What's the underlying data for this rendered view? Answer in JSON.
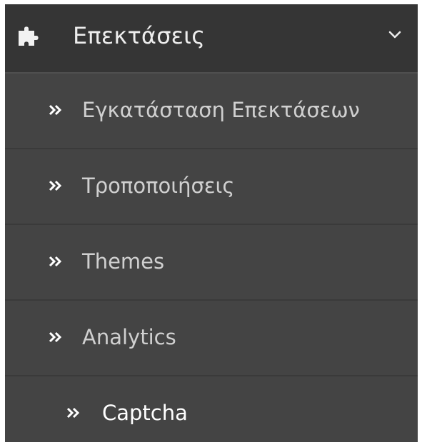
{
  "menu": {
    "header": {
      "label": "Επεκτάσεις",
      "icon": "puzzle-icon",
      "toggle_icon": "chevron-down-icon"
    },
    "items": [
      {
        "label": "Εγκατάσταση Επεκτάσεων",
        "icon": "double-chevron-right-icon",
        "active": false
      },
      {
        "label": "Τροποποιήσεις",
        "icon": "double-chevron-right-icon",
        "active": false
      },
      {
        "label": "Themes",
        "icon": "double-chevron-right-icon",
        "active": false
      },
      {
        "label": "Analytics",
        "icon": "double-chevron-right-icon",
        "active": false
      },
      {
        "label": "Captcha",
        "icon": "double-chevron-right-icon",
        "active": true
      }
    ]
  },
  "colors": {
    "menu_background": "#444444",
    "header_background": "#353535",
    "text": "#d0d0d0",
    "active_text": "#ffffff"
  }
}
